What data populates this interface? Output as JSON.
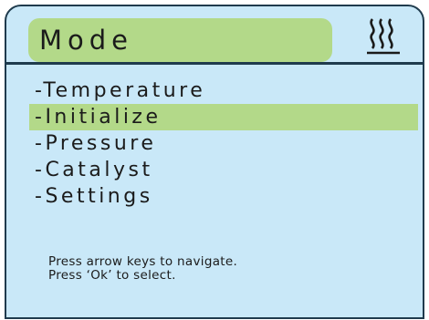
{
  "header": {
    "title": "Mode",
    "icon": "heat-icon"
  },
  "menu": {
    "items": [
      {
        "label": "-Temperature",
        "selected": false
      },
      {
        "label": "-Initialize",
        "selected": true
      },
      {
        "label": "-Pressure",
        "selected": false
      },
      {
        "label": "-Catalyst",
        "selected": false
      },
      {
        "label": "-Settings",
        "selected": false
      }
    ]
  },
  "help": {
    "line1": "Press arrow keys to navigate.",
    "line2": "Press ‘Ok’ to select."
  },
  "colors": {
    "screen_background": "#c9e8f8",
    "highlight": "#b3d989",
    "border": "#1f3b4d",
    "text": "#1b1b1b"
  }
}
